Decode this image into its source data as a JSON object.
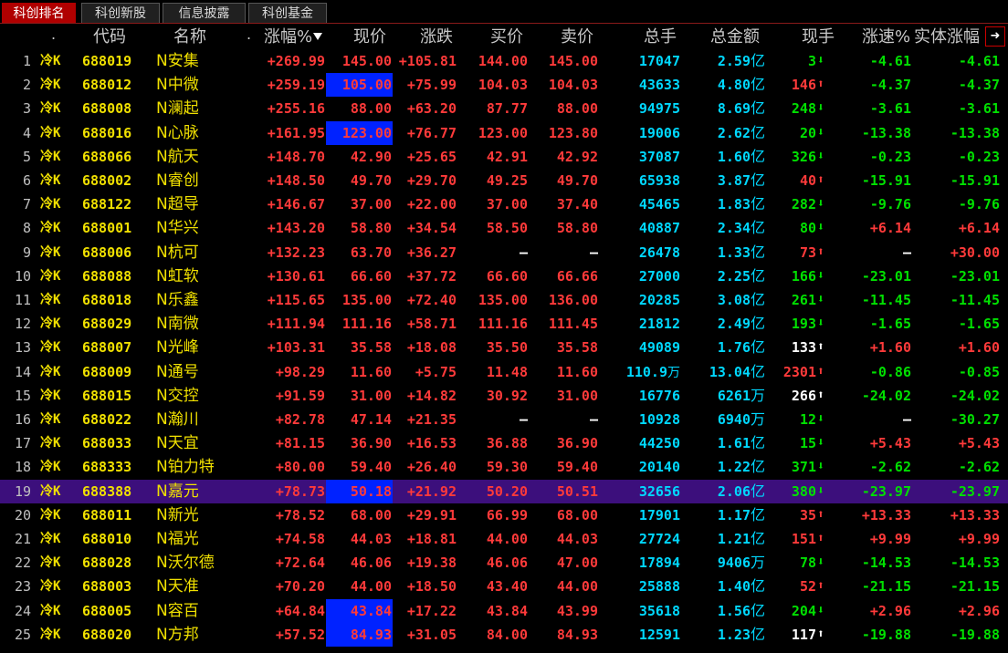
{
  "tabs": [
    {
      "label": "科创排名",
      "active": true
    },
    {
      "label": "科创新股",
      "active": false
    },
    {
      "label": "信息披露",
      "active": false
    },
    {
      "label": "科创基金",
      "active": false
    }
  ],
  "header": {
    "dot1": ".",
    "code": "代码",
    "name": "名称",
    "dot2": ".",
    "change_pct": "涨幅%",
    "price": "现价",
    "change": "涨跌",
    "bid": "买价",
    "ask": "卖价",
    "volume": "总手",
    "amount": "总金额",
    "last_vol": "现手",
    "speed": "涨速%",
    "body_change": "实体涨幅"
  },
  "colors": {
    "up": "#ff3a3a",
    "down": "#00e000",
    "neutral": "#ffffff",
    "highlight": "#0022ff",
    "selected": "#3c0f7c"
  },
  "rows": [
    {
      "idx": "1",
      "tag": "冷K",
      "code": "688019",
      "name": "N安集",
      "chg": "+269.99",
      "price": "145.00",
      "price_hl": false,
      "diff": "+105.81",
      "bid": "144.00",
      "ask": "145.00",
      "vol": "17047",
      "amt": "2.59",
      "amt_unit": "亿",
      "now": "3",
      "dir": "down",
      "speed": "-4.61",
      "speed_dir": "down",
      "body": "-4.61",
      "body_dir": "down"
    },
    {
      "idx": "2",
      "tag": "冷K",
      "code": "688012",
      "name": "N中微",
      "chg": "+259.19",
      "price": "105.00",
      "price_hl": true,
      "diff": "+75.99",
      "bid": "104.03",
      "ask": "104.03",
      "vol": "43633",
      "amt": "4.80",
      "amt_unit": "亿",
      "now": "146",
      "dir": "up",
      "speed": "-4.37",
      "speed_dir": "down",
      "body": "-4.37",
      "body_dir": "down"
    },
    {
      "idx": "3",
      "tag": "冷K",
      "code": "688008",
      "name": "N澜起",
      "chg": "+255.16",
      "price": "88.00",
      "price_hl": false,
      "diff": "+63.20",
      "bid": "87.77",
      "ask": "88.00",
      "vol": "94975",
      "amt": "8.69",
      "amt_unit": "亿",
      "now": "248",
      "dir": "down",
      "speed": "-3.61",
      "speed_dir": "down",
      "body": "-3.61",
      "body_dir": "down"
    },
    {
      "idx": "4",
      "tag": "冷K",
      "code": "688016",
      "name": "N心脉",
      "chg": "+161.95",
      "price": "123.00",
      "price_hl": true,
      "diff": "+76.77",
      "bid": "123.00",
      "ask": "123.80",
      "vol": "19006",
      "amt": "2.62",
      "amt_unit": "亿",
      "now": "20",
      "dir": "down",
      "speed": "-13.38",
      "speed_dir": "down",
      "body": "-13.38",
      "body_dir": "down"
    },
    {
      "idx": "5",
      "tag": "冷K",
      "code": "688066",
      "name": "N航天",
      "chg": "+148.70",
      "price": "42.90",
      "price_hl": false,
      "diff": "+25.65",
      "bid": "42.91",
      "ask": "42.92",
      "vol": "37087",
      "amt": "1.60",
      "amt_unit": "亿",
      "now": "326",
      "dir": "down",
      "speed": "-0.23",
      "speed_dir": "down",
      "body": "-0.23",
      "body_dir": "down"
    },
    {
      "idx": "6",
      "tag": "冷K",
      "code": "688002",
      "name": "N睿创",
      "chg": "+148.50",
      "price": "49.70",
      "price_hl": false,
      "diff": "+29.70",
      "bid": "49.25",
      "ask": "49.70",
      "vol": "65938",
      "amt": "3.87",
      "amt_unit": "亿",
      "now": "40",
      "dir": "up",
      "speed": "-15.91",
      "speed_dir": "down",
      "body": "-15.91",
      "body_dir": "down"
    },
    {
      "idx": "7",
      "tag": "冷K",
      "code": "688122",
      "name": "N超导",
      "chg": "+146.67",
      "price": "37.00",
      "price_hl": false,
      "diff": "+22.00",
      "bid": "37.00",
      "ask": "37.40",
      "vol": "45465",
      "amt": "1.83",
      "amt_unit": "亿",
      "now": "282",
      "dir": "down",
      "speed": "-9.76",
      "speed_dir": "down",
      "body": "-9.76",
      "body_dir": "down"
    },
    {
      "idx": "8",
      "tag": "冷K",
      "code": "688001",
      "name": "N华兴",
      "chg": "+143.20",
      "price": "58.80",
      "price_hl": false,
      "diff": "+34.54",
      "bid": "58.50",
      "ask": "58.80",
      "vol": "40887",
      "amt": "2.34",
      "amt_unit": "亿",
      "now": "80",
      "dir": "down",
      "speed": "+6.14",
      "speed_dir": "up",
      "body": "+6.14",
      "body_dir": "up"
    },
    {
      "idx": "9",
      "tag": "冷K",
      "code": "688006",
      "name": "N杭可",
      "chg": "+132.23",
      "price": "63.70",
      "price_hl": false,
      "diff": "+36.27",
      "bid": "—",
      "ask": "—",
      "vol": "26478",
      "amt": "1.33",
      "amt_unit": "亿",
      "now": "73",
      "dir": "up",
      "speed": "—",
      "speed_dir": "neutral",
      "body": "+30.00",
      "body_dir": "up"
    },
    {
      "idx": "10",
      "tag": "冷K",
      "code": "688088",
      "name": "N虹软",
      "chg": "+130.61",
      "price": "66.60",
      "price_hl": false,
      "diff": "+37.72",
      "bid": "66.60",
      "ask": "66.66",
      "vol": "27000",
      "amt": "2.25",
      "amt_unit": "亿",
      "now": "166",
      "dir": "down",
      "speed": "-23.01",
      "speed_dir": "down",
      "body": "-23.01",
      "body_dir": "down"
    },
    {
      "idx": "11",
      "tag": "冷K",
      "code": "688018",
      "name": "N乐鑫",
      "chg": "+115.65",
      "price": "135.00",
      "price_hl": false,
      "diff": "+72.40",
      "bid": "135.00",
      "ask": "136.00",
      "vol": "20285",
      "amt": "3.08",
      "amt_unit": "亿",
      "now": "261",
      "dir": "down",
      "speed": "-11.45",
      "speed_dir": "down",
      "body": "-11.45",
      "body_dir": "down"
    },
    {
      "idx": "12",
      "tag": "冷K",
      "code": "688029",
      "name": "N南微",
      "chg": "+111.94",
      "price": "111.16",
      "price_hl": false,
      "diff": "+58.71",
      "bid": "111.16",
      "ask": "111.45",
      "vol": "21812",
      "amt": "2.49",
      "amt_unit": "亿",
      "now": "193",
      "dir": "down",
      "speed": "-1.65",
      "speed_dir": "down",
      "body": "-1.65",
      "body_dir": "down"
    },
    {
      "idx": "13",
      "tag": "冷K",
      "code": "688007",
      "name": "N光峰",
      "chg": "+103.31",
      "price": "35.58",
      "price_hl": false,
      "diff": "+18.08",
      "bid": "35.50",
      "ask": "35.58",
      "vol": "49089",
      "amt": "1.76",
      "amt_unit": "亿",
      "now": "133",
      "dir": "neutral",
      "speed": "+1.60",
      "speed_dir": "up",
      "body": "+1.60",
      "body_dir": "up"
    },
    {
      "idx": "14",
      "tag": "冷K",
      "code": "688009",
      "name": "N通号",
      "chg": "+98.29",
      "price": "11.60",
      "price_hl": false,
      "diff": "+5.75",
      "bid": "11.48",
      "ask": "11.60",
      "vol": "110.9",
      "vol_unit": "万",
      "amt": "13.04",
      "amt_unit": "亿",
      "now": "2301",
      "dir": "up",
      "speed": "-0.86",
      "speed_dir": "down",
      "body": "-0.85",
      "body_dir": "down"
    },
    {
      "idx": "15",
      "tag": "冷K",
      "code": "688015",
      "name": "N交控",
      "chg": "+91.59",
      "price": "31.00",
      "price_hl": false,
      "diff": "+14.82",
      "bid": "30.92",
      "ask": "31.00",
      "vol": "16776",
      "amt": "6261",
      "amt_unit": "万",
      "now": "266",
      "dir": "neutral",
      "speed": "-24.02",
      "speed_dir": "down",
      "body": "-24.02",
      "body_dir": "down"
    },
    {
      "idx": "16",
      "tag": "冷K",
      "code": "688022",
      "name": "N瀚川",
      "chg": "+82.78",
      "price": "47.14",
      "price_hl": false,
      "diff": "+21.35",
      "bid": "—",
      "ask": "—",
      "vol": "10928",
      "amt": "6940",
      "amt_unit": "万",
      "now": "12",
      "dir": "down",
      "speed": "—",
      "speed_dir": "neutral",
      "body": "-30.27",
      "body_dir": "down"
    },
    {
      "idx": "17",
      "tag": "冷K",
      "code": "688033",
      "name": "N天宜",
      "chg": "+81.15",
      "price": "36.90",
      "price_hl": false,
      "diff": "+16.53",
      "bid": "36.88",
      "ask": "36.90",
      "vol": "44250",
      "amt": "1.61",
      "amt_unit": "亿",
      "now": "15",
      "dir": "down",
      "speed": "+5.43",
      "speed_dir": "up",
      "body": "+5.43",
      "body_dir": "up"
    },
    {
      "idx": "18",
      "tag": "冷K",
      "code": "688333",
      "name": "N铂力特",
      "chg": "+80.00",
      "price": "59.40",
      "price_hl": false,
      "diff": "+26.40",
      "bid": "59.30",
      "ask": "59.40",
      "vol": "20140",
      "amt": "1.22",
      "amt_unit": "亿",
      "now": "371",
      "dir": "down",
      "speed": "-2.62",
      "speed_dir": "down",
      "body": "-2.62",
      "body_dir": "down"
    },
    {
      "idx": "19",
      "tag": "冷K",
      "code": "688388",
      "name": "N嘉元",
      "chg": "+78.73",
      "price": "50.18",
      "price_hl": true,
      "diff": "+21.92",
      "bid": "50.20",
      "ask": "50.51",
      "vol": "32656",
      "amt": "2.06",
      "amt_unit": "亿",
      "now": "380",
      "dir": "down",
      "speed": "-23.97",
      "speed_dir": "down",
      "body": "-23.97",
      "body_dir": "down",
      "selected": true
    },
    {
      "idx": "20",
      "tag": "冷K",
      "code": "688011",
      "name": "N新光",
      "chg": "+78.52",
      "price": "68.00",
      "price_hl": false,
      "diff": "+29.91",
      "bid": "66.99",
      "ask": "68.00",
      "vol": "17901",
      "amt": "1.17",
      "amt_unit": "亿",
      "now": "35",
      "dir": "up",
      "speed": "+13.33",
      "speed_dir": "up",
      "body": "+13.33",
      "body_dir": "up"
    },
    {
      "idx": "21",
      "tag": "冷K",
      "code": "688010",
      "name": "N福光",
      "chg": "+74.58",
      "price": "44.03",
      "price_hl": false,
      "diff": "+18.81",
      "bid": "44.00",
      "ask": "44.03",
      "vol": "27724",
      "amt": "1.21",
      "amt_unit": "亿",
      "now": "151",
      "dir": "up",
      "speed": "+9.99",
      "speed_dir": "up",
      "body": "+9.99",
      "body_dir": "up"
    },
    {
      "idx": "22",
      "tag": "冷K",
      "code": "688028",
      "name": "N沃尔德",
      "chg": "+72.64",
      "price": "46.06",
      "price_hl": false,
      "diff": "+19.38",
      "bid": "46.06",
      "ask": "47.00",
      "vol": "17894",
      "amt": "9406",
      "amt_unit": "万",
      "now": "78",
      "dir": "down",
      "speed": "-14.53",
      "speed_dir": "down",
      "body": "-14.53",
      "body_dir": "down"
    },
    {
      "idx": "23",
      "tag": "冷K",
      "code": "688003",
      "name": "N天准",
      "chg": "+70.20",
      "price": "44.00",
      "price_hl": false,
      "diff": "+18.50",
      "bid": "43.40",
      "ask": "44.00",
      "vol": "25888",
      "amt": "1.40",
      "amt_unit": "亿",
      "now": "52",
      "dir": "up",
      "speed": "-21.15",
      "speed_dir": "down",
      "body": "-21.15",
      "body_dir": "down"
    },
    {
      "idx": "24",
      "tag": "冷K",
      "code": "688005",
      "name": "N容百",
      "chg": "+64.84",
      "price": "43.84",
      "price_hl": true,
      "diff": "+17.22",
      "bid": "43.84",
      "ask": "43.99",
      "vol": "35618",
      "amt": "1.56",
      "amt_unit": "亿",
      "now": "204",
      "dir": "down",
      "speed": "+2.96",
      "speed_dir": "up",
      "body": "+2.96",
      "body_dir": "up"
    },
    {
      "idx": "25",
      "tag": "冷K",
      "code": "688020",
      "name": "N方邦",
      "chg": "+57.52",
      "price": "84.93",
      "price_hl": true,
      "diff": "+31.05",
      "bid": "84.00",
      "ask": "84.93",
      "vol": "12591",
      "amt": "1.23",
      "amt_unit": "亿",
      "now": "117",
      "dir": "neutral",
      "speed": "-19.88",
      "speed_dir": "down",
      "body": "-19.88",
      "body_dir": "down"
    }
  ]
}
